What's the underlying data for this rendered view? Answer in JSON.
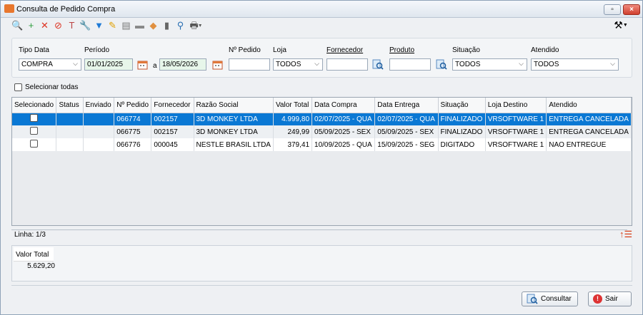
{
  "window": {
    "title": "Consulta de Pedido Compra",
    "maximize_glyph": "▫",
    "close_glyph": "×"
  },
  "toolbar": {
    "icons": [
      {
        "name": "search-doc-icon",
        "glyph": "🔍",
        "color": "#2a6fb3"
      },
      {
        "name": "new-doc-icon",
        "glyph": "+",
        "color": "#2e9e3e"
      },
      {
        "name": "delete-icon",
        "glyph": "✕",
        "color": "#d32"
      },
      {
        "name": "cancel-icon",
        "glyph": "⊘",
        "color": "#d32"
      },
      {
        "name": "hammer-icon",
        "glyph": "T",
        "color": "#b44"
      },
      {
        "name": "wrench-icon",
        "glyph": "🔧",
        "color": "#c33"
      },
      {
        "name": "filter-icon",
        "glyph": "▼",
        "color": "#1f7ad6"
      },
      {
        "name": "edit-icon",
        "glyph": "✎",
        "color": "#e0a000"
      },
      {
        "name": "sheet-icon",
        "glyph": "▤",
        "color": "#777"
      },
      {
        "name": "folder-icon",
        "glyph": "▬",
        "color": "#888"
      },
      {
        "name": "tag-icon",
        "glyph": "◆",
        "color": "#e09040"
      },
      {
        "name": "stamp-icon",
        "glyph": "▮",
        "color": "#666"
      },
      {
        "name": "search-icon",
        "glyph": "⚲",
        "color": "#2a6fb3"
      },
      {
        "name": "print-icon",
        "glyph": "🖶",
        "color": "#555"
      }
    ],
    "tools_icon": "⚒"
  },
  "filters": {
    "tipo_data": {
      "label": "Tipo Data",
      "value": "COMPRA"
    },
    "periodo": {
      "label": "Período",
      "from": "01/01/2025",
      "separator": "a",
      "to": "18/05/2026"
    },
    "pedido": {
      "label": "Nº Pedido",
      "value": ""
    },
    "loja": {
      "label": "Loja",
      "value": "TODOS"
    },
    "fornecedor": {
      "label": "Fornecedor",
      "value": ""
    },
    "produto": {
      "label": "Produto",
      "value": ""
    },
    "situacao": {
      "label": "Situação",
      "value": "TODOS"
    },
    "atendido": {
      "label": "Atendido",
      "value": "TODOS"
    }
  },
  "select_all": {
    "label": "Selecionar todas",
    "checked": false
  },
  "grid": {
    "columns": [
      "Selecionado",
      "Status",
      "Enviado",
      "Nº Pedido",
      "Fornecedor",
      "Razão Social",
      "Valor Total",
      "Data Compra",
      "Data Entrega",
      "Situação",
      "Loja Destino",
      "Atendido"
    ],
    "rows": [
      {
        "numero": "066774",
        "fornecedor": "002157",
        "razao": "3D MONKEY LTDA",
        "valor": "4.999,80",
        "compra": "02/07/2025 - QUA",
        "entrega": "02/07/2025 - QUA",
        "situacao": "FINALIZADO",
        "loja": "VRSOFTWARE 1",
        "atendido": "ENTREGA CANCELADA"
      },
      {
        "numero": "066775",
        "fornecedor": "002157",
        "razao": "3D MONKEY LTDA",
        "valor": "249,99",
        "compra": "05/09/2025 - SEX",
        "entrega": "05/09/2025 - SEX",
        "situacao": "FINALIZADO",
        "loja": "VRSOFTWARE 1",
        "atendido": "ENTREGA CANCELADA"
      },
      {
        "numero": "066776",
        "fornecedor": "000045",
        "razao": "NESTLE BRASIL LTDA",
        "valor": "379,41",
        "compra": "10/09/2025 - QUA",
        "entrega": "15/09/2025 - SEG",
        "situacao": "DIGITADO",
        "loja": "VRSOFTWARE 1",
        "atendido": "NAO ENTREGUE"
      }
    ],
    "selected_row": 0
  },
  "status": {
    "linha": "Linha: 1/3"
  },
  "totals": {
    "label": "Valor Total",
    "value": "5.629,20"
  },
  "buttons": {
    "consultar": "Consultar",
    "sair": "Sair"
  },
  "colors": {
    "selection": "#0a78d4",
    "accent_red": "#d32f2f"
  }
}
